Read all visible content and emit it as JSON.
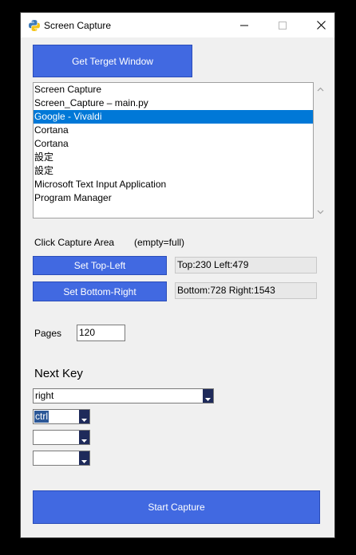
{
  "window": {
    "title": "Screen Capture",
    "controls": {
      "minimize": "—",
      "maximize": "☐",
      "close": "✕"
    }
  },
  "get_window_button": "Get Terget Window",
  "window_list": {
    "items": [
      "Screen Capture",
      "Screen_Capture – main.py",
      "Google - Vivaldi",
      "Cortana",
      "Cortana",
      "設定",
      "設定",
      "Microsoft Text Input Application",
      "Program Manager"
    ],
    "selected_index": 2
  },
  "capture_area": {
    "label": "Click Capture Area",
    "hint": "(empty=full)",
    "top_left_button": "Set Top-Left",
    "top_left_readout": "Top:230  Left:479",
    "bottom_right_button": "Set Bottom-Right",
    "bottom_right_readout": "Bottom:728  Right:1543"
  },
  "pages": {
    "label": "Pages",
    "value": "120"
  },
  "next_key": {
    "label": "Next Key",
    "key_value": "right",
    "modifier1_value": "ctrl",
    "modifier2_value": "",
    "modifier3_value": ""
  },
  "start_button": "Start Capture",
  "colors": {
    "button_blue": "#4169e1",
    "selection_blue": "#0078d7",
    "dropdown_navy": "#1e2a5a"
  },
  "icons": [
    "python-icon",
    "minimize-icon",
    "maximize-icon",
    "close-icon",
    "scroll-up-icon",
    "scroll-down-icon",
    "dropdown-arrow-icon"
  ]
}
